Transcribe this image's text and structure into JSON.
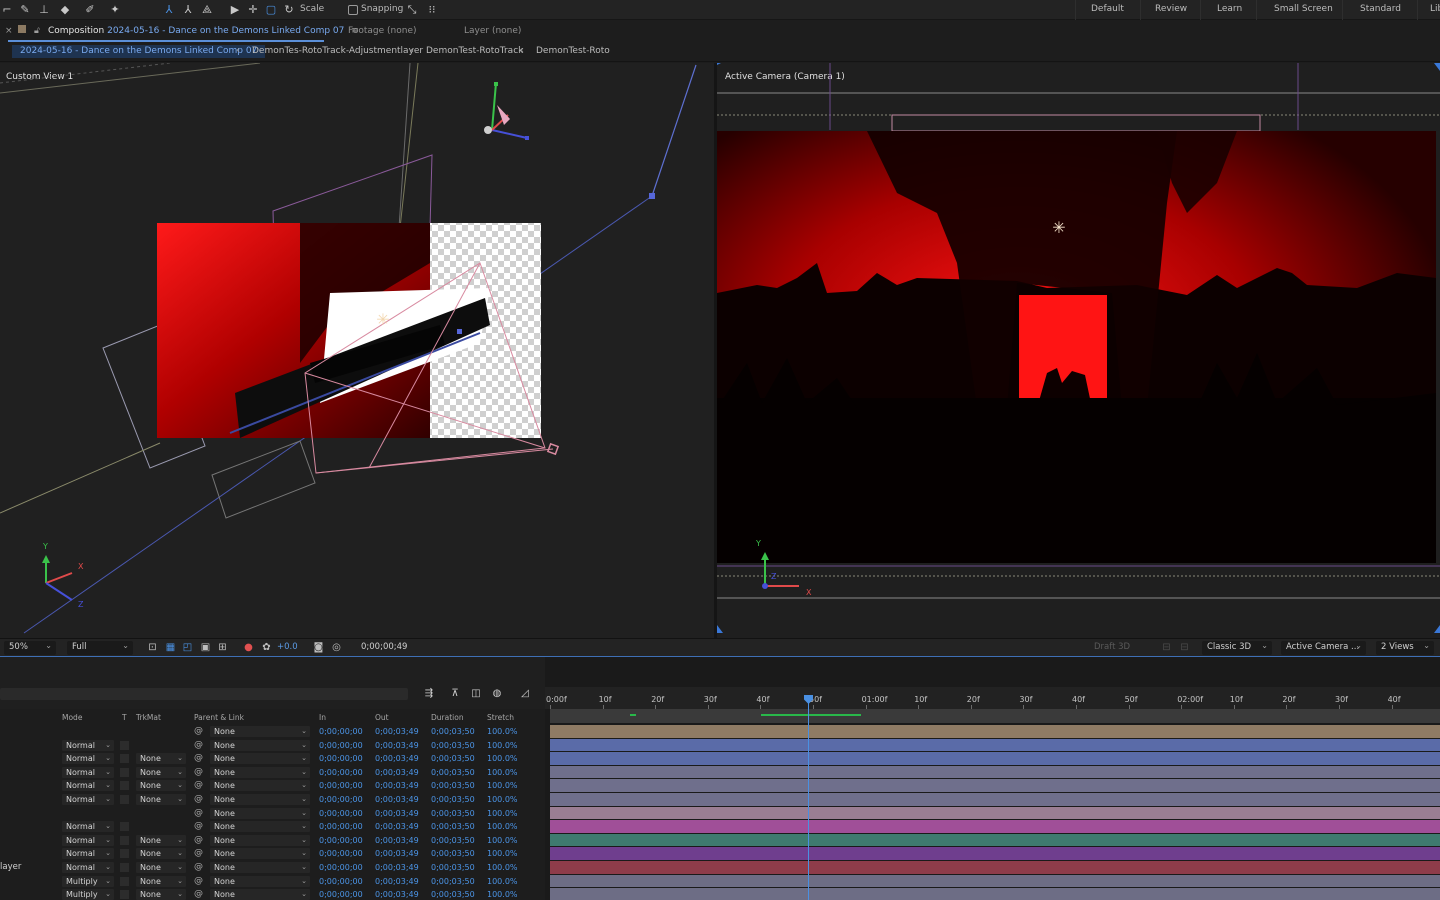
{
  "toolbar": {
    "scale_label": "Scale",
    "snapping_label": "Snapping",
    "workspaces": [
      "Default",
      "Review",
      "Learn",
      "Small Screen",
      "Standard",
      "Lib"
    ]
  },
  "panels": {
    "composition_prefix": "Composition",
    "composition_name": "2024-05-16 - Dance on the Demons Linked Comp 07",
    "footage_tab": "Footage (none)",
    "layer_tab": "Layer (none)"
  },
  "breadcrumbs": [
    "2024-05-16 - Dance on the Demons Linked Comp 07",
    "DemonTes-RotoTrack-Adjustmentlayer",
    "DemonTest-RotoTrack",
    "DemonTest-Roto"
  ],
  "viewers": {
    "left_label": "Custom View 1",
    "right_label": "Active Camera (Camera 1)",
    "axis_labels": {
      "x": "X",
      "y": "Y",
      "z": "Z"
    }
  },
  "footer": {
    "zoom": "50%",
    "resolution": "Full",
    "exposure": "+0.0",
    "timecode": "0;00;00;49",
    "draft3d": "Draft 3D",
    "renderer": "Classic 3D",
    "camera": "Active Camera ...",
    "views": "2 Views"
  },
  "timeline": {
    "columns": {
      "mode": "Mode",
      "t": "T",
      "trkmat": "TrkMat",
      "parent": "Parent & Link",
      "in": "In",
      "out": "Out",
      "duration": "Duration",
      "stretch": "Stretch"
    },
    "ruler_ticks": [
      "0:00f",
      "10f",
      "20f",
      "30f",
      "40f",
      "50f",
      "01:00f",
      "10f",
      "20f",
      "30f",
      "40f",
      "50f",
      "02:00f",
      "10f",
      "20f",
      "30f",
      "40f"
    ],
    "layers": [
      {
        "name": "",
        "mode": "",
        "trkmat": "",
        "parent": "None",
        "in": "0;00;00;00",
        "out": "0;00;03;49",
        "duration": "0;00;03;50",
        "stretch": "100.0%",
        "color": "#8f7b64"
      },
      {
        "name": "",
        "mode": "Normal",
        "trkmat": "",
        "parent": "None",
        "in": "0;00;00;00",
        "out": "0;00;03;49",
        "duration": "0;00;03;50",
        "stretch": "100.0%",
        "color": "#5a6ba8"
      },
      {
        "name": "",
        "mode": "Normal",
        "trkmat": "None",
        "parent": "None",
        "in": "0;00;00;00",
        "out": "0;00;03;49",
        "duration": "0;00;03;50",
        "stretch": "100.0%",
        "color": "#5a6ba8"
      },
      {
        "name": "",
        "mode": "Normal",
        "trkmat": "None",
        "parent": "None",
        "in": "0;00;00;00",
        "out": "0;00;03;49",
        "duration": "0;00;03;50",
        "stretch": "100.0%",
        "color": "#6f6f8c"
      },
      {
        "name": "",
        "mode": "Normal",
        "trkmat": "None",
        "parent": "None",
        "in": "0;00;00;00",
        "out": "0;00;03;49",
        "duration": "0;00;03;50",
        "stretch": "100.0%",
        "color": "#6f6f8c"
      },
      {
        "name": "",
        "mode": "Normal",
        "trkmat": "None",
        "parent": "None",
        "in": "0;00;00;00",
        "out": "0;00;03;49",
        "duration": "0;00;03;50",
        "stretch": "100.0%",
        "color": "#6f6f8c"
      },
      {
        "name": "",
        "mode": "",
        "trkmat": "",
        "parent": "None",
        "in": "0;00;00;00",
        "out": "0;00;03;49",
        "duration": "0;00;03;50",
        "stretch": "100.0%",
        "color": "#9a7e93"
      },
      {
        "name": "",
        "mode": "Normal",
        "trkmat": "",
        "parent": "None",
        "in": "0;00;00;00",
        "out": "0;00;03;49",
        "duration": "0;00;03;50",
        "stretch": "100.0%",
        "color": "#a04f98"
      },
      {
        "name": "",
        "mode": "Normal",
        "trkmat": "None",
        "parent": "None",
        "in": "0;00;00;00",
        "out": "0;00;03;49",
        "duration": "0;00;03;50",
        "stretch": "100.0%",
        "color": "#3f7a6f"
      },
      {
        "name": "",
        "mode": "Normal",
        "trkmat": "None",
        "parent": "None",
        "in": "0;00;00;00",
        "out": "0;00;03;49",
        "duration": "0;00;03;50",
        "stretch": "100.0%",
        "color": "#6f3e8e"
      },
      {
        "name": "layer",
        "mode": "Normal",
        "trkmat": "None",
        "parent": "None",
        "in": "0;00;00;00",
        "out": "0;00;03;49",
        "duration": "0;00;03;50",
        "stretch": "100.0%",
        "color": "#8e3c4a"
      },
      {
        "name": "",
        "mode": "Multiply",
        "trkmat": "None",
        "parent": "None",
        "in": "0;00;00;00",
        "out": "0;00;03;49",
        "duration": "0;00;03;50",
        "stretch": "100.0%",
        "color": "#6d6d85"
      },
      {
        "name": "",
        "mode": "Multiply",
        "trkmat": "None",
        "parent": "None",
        "in": "0;00;00;00",
        "out": "0;00;03;49",
        "duration": "0;00;03;50",
        "stretch": "100.0%",
        "color": "#6d6d85"
      }
    ]
  }
}
